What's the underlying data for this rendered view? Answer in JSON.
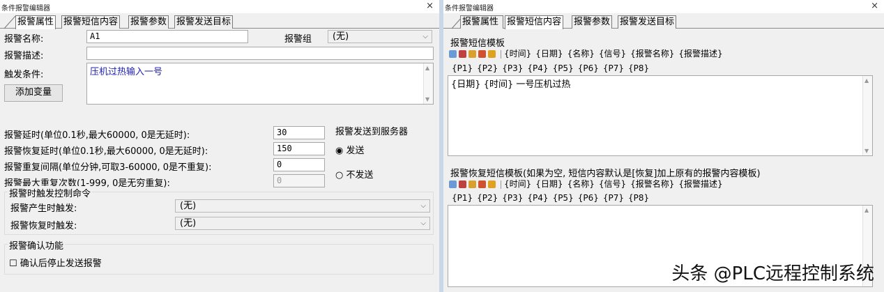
{
  "left": {
    "title": "条件报警编辑器",
    "close": "×",
    "tabs": [
      "报警属性",
      "报警短信内容",
      "报警参数",
      "报警发送目标"
    ],
    "name_label": "报警名称:",
    "name_value": "A1",
    "group_label": "报警组",
    "group_value": "(无)",
    "desc_label": "报警描述:",
    "desc_value": "",
    "trigger_label": "触发条件:",
    "trigger_value": "压机过热输入一号",
    "add_var_button": "添加变量",
    "delay_label": "报警延时(单位0.1秒,最大60000, 0是无延时):",
    "delay_value": "30",
    "recover_delay_label": "报警恢复延时(单位0.1秒,最大60000, 0是无延时):",
    "recover_delay_value": "150",
    "repeat_interval_label": "报警重复间隔(单位分钟,可取3-60000, 0是不重复):",
    "repeat_interval_value": "0",
    "max_repeat_label": "报警最大重复次数(1-999, 0是无穷重复):",
    "max_repeat_value": "0",
    "server_group_label": "报警发送到服务器",
    "radio_send": "发送",
    "radio_no_send": "不发送",
    "trigger_cmd_group": "报警时触发控制命令",
    "on_alarm_label": "报警产生时触发:",
    "on_alarm_value": "(无)",
    "on_recover_label": "报警恢复时触发:",
    "on_recover_value": "(无)",
    "confirm_group": "报警确认功能",
    "confirm_checkbox": "确认后停止发送报警"
  },
  "right": {
    "title": "条件报警编辑器",
    "close": "×",
    "tabs": [
      "报警属性",
      "报警短信内容",
      "报警参数",
      "报警发送目标"
    ],
    "sms_template_label": "报警短信模板",
    "tokens_row1": [
      "{时间}",
      "{日期}",
      "{名称}",
      "{信号}",
      "{报警名称}",
      "{报警描述}"
    ],
    "tokens_row2": [
      "{P1}",
      "{P2}",
      "{P3}",
      "{P4}",
      "{P5}",
      "{P6}",
      "{P7}",
      "{P8}"
    ],
    "sms_template_value": "{日期} {时间} 一号压机过热",
    "recover_template_label": "报警恢复短信模板(如果为空, 短信内容默认是[恢复]加上原有的报警内容模板)",
    "recover_template_value": ""
  },
  "watermark": "头条 @PLC远程控制系统",
  "colors": {
    "tab_active": "#ffffff",
    "trigger_text": "#2020b0",
    "background": "#f0f0f0"
  },
  "icons": [
    "copy-icon",
    "cut-icon",
    "paste-icon",
    "undo-icon",
    "redo-icon"
  ]
}
